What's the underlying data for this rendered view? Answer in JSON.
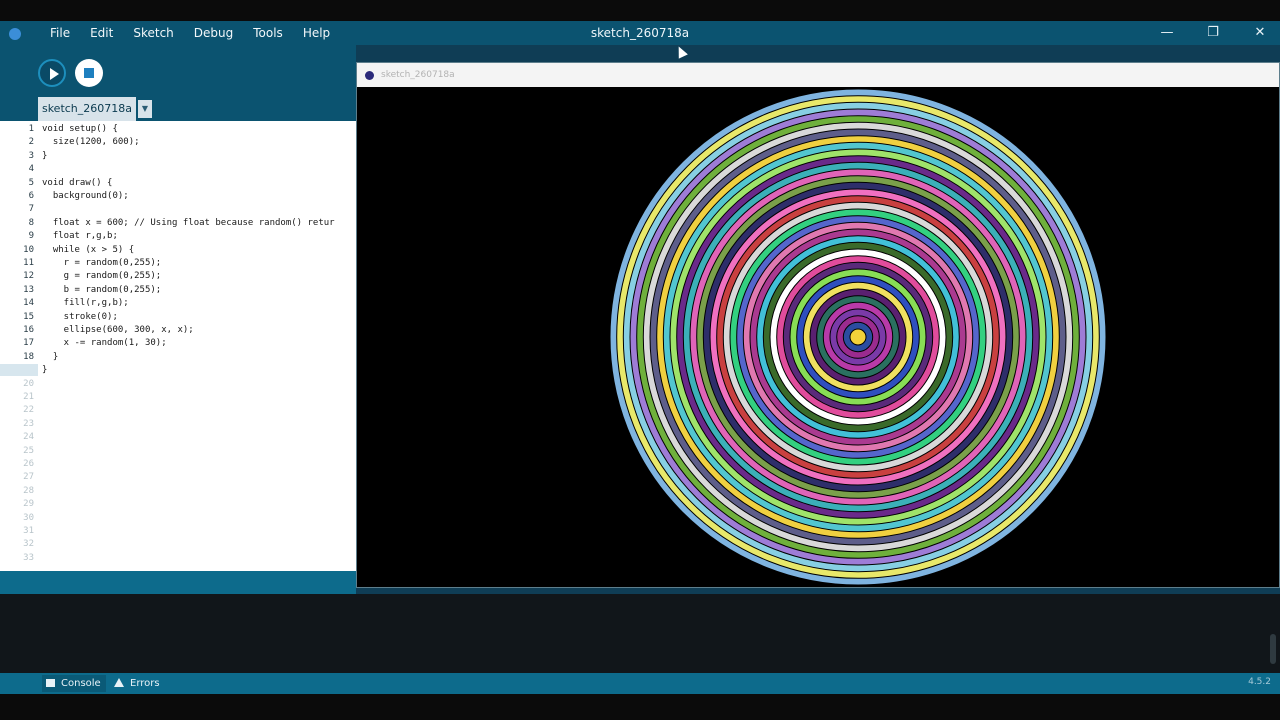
{
  "window": {
    "title": "sketch_260718a"
  },
  "menu": [
    "File",
    "Edit",
    "Sketch",
    "Debug",
    "Tools",
    "Help"
  ],
  "editor": {
    "tab_label": "sketch_260718a",
    "tab_arrow": "▼",
    "line_numbers": [
      "1",
      "2",
      "3",
      "4",
      "5",
      "6",
      "7",
      "8",
      "9",
      "10",
      "11",
      "12",
      "13",
      "14",
      "15",
      "16",
      "17",
      "18",
      "19",
      "20",
      "21",
      "22",
      "23",
      "24",
      "25",
      "26",
      "27",
      "28",
      "29",
      "30",
      "31",
      "32",
      "33"
    ],
    "code": [
      "void setup() {",
      "  size(1200, 600);",
      "}",
      "",
      "void draw() {",
      "  background(0);",
      "",
      "  float x = 600; // Using float because random() retur",
      "  float r,g,b;",
      "  while (x > 5) {",
      "    r = random(0,255);",
      "    g = random(0,255);",
      "    b = random(0,255);",
      "    fill(r,g,b);",
      "    stroke(0);",
      "    ellipse(600, 300, x, x);",
      "    x -= random(1, 30);",
      "  }",
      "}"
    ]
  },
  "sketch_window": {
    "title": "sketch_260718a"
  },
  "console": {
    "console_label": "Console",
    "errors_label": "Errors",
    "version": "4.5.2"
  },
  "ring_colors": [
    "#7fb4e0",
    "#e8e86a",
    "#87cfe3",
    "#9e7cd6",
    "#6fb03c",
    "#d9d9d9",
    "#5e5e8a",
    "#f0d040",
    "#52c6d0",
    "#9fe36a",
    "#6a2a8a",
    "#3bb0b8",
    "#e064b8",
    "#7aa04a",
    "#2e2e6a",
    "#f070c0",
    "#c94040",
    "#d8d8d8",
    "#33d080",
    "#5566cc",
    "#e078b0",
    "#aa3a90",
    "#42c0d8",
    "#3a6a2a",
    "#ffffff",
    "#e04c9c",
    "#5a2a7a",
    "#88dd55",
    "#2f4fbf",
    "#f0e060",
    "#5a2070",
    "#2a7060",
    "#b83aa8",
    "#7a3aa8",
    "#9b2b8f",
    "#2b4da0",
    "#f2d23a"
  ]
}
